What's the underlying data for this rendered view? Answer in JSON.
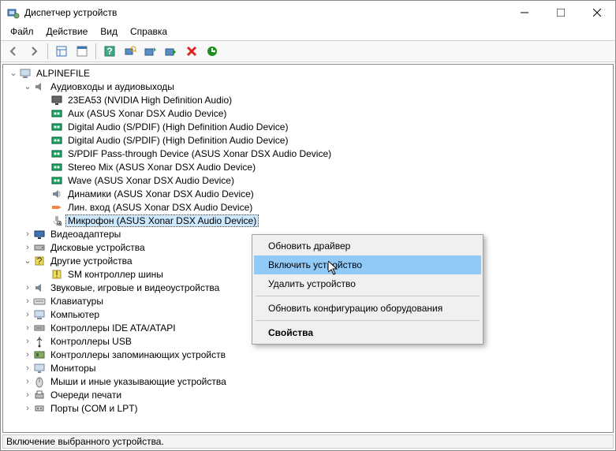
{
  "window": {
    "title": "Диспетчер устройств"
  },
  "menu": {
    "file": "Файл",
    "action": "Действие",
    "view": "Вид",
    "help": "Справка"
  },
  "root": {
    "label": "ALPINEFILE"
  },
  "tree": {
    "audio": {
      "label": "Аудиовходы и аудиовыходы",
      "items": [
        "23EA53 (NVIDIA High Definition Audio)",
        "Aux (ASUS Xonar DSX Audio Device)",
        "Digital Audio (S/PDIF) (High Definition Audio Device)",
        "Digital Audio (S/PDIF) (High Definition Audio Device)",
        "S/PDIF Pass-through Device (ASUS Xonar DSX Audio Device)",
        "Stereo Mix (ASUS Xonar DSX Audio Device)",
        "Wave (ASUS Xonar DSX Audio Device)",
        "Динамики (ASUS Xonar DSX Audio Device)",
        "Лин. вход (ASUS Xonar DSX Audio Device)",
        "Микрофон (ASUS Xonar DSX Audio Device)"
      ]
    },
    "display": {
      "label": "Видеоадаптеры"
    },
    "disk": {
      "label": "Дисковые устройства"
    },
    "other": {
      "label": "Другие устройства",
      "items": [
        "SM контроллер шины"
      ]
    },
    "game": {
      "label": "Звуковые, игровые и видеоустройства"
    },
    "keyboard": {
      "label": "Клавиатуры"
    },
    "computer": {
      "label": "Компьютер"
    },
    "ide": {
      "label": "Контроллеры IDE ATA/ATAPI"
    },
    "usb": {
      "label": "Контроллеры USB"
    },
    "storage": {
      "label": "Контроллеры запоминающих устройств"
    },
    "monitor": {
      "label": "Мониторы"
    },
    "mouse": {
      "label": "Мыши и иные указывающие устройства"
    },
    "printq": {
      "label": "Очереди печати"
    },
    "ports": {
      "label": "Порты (COM и LPT)"
    }
  },
  "ctx": {
    "update": "Обновить драйвер",
    "enable": "Включить устройство",
    "delete": "Удалить устройство",
    "scan": "Обновить конфигурацию оборудования",
    "props": "Свойства"
  },
  "status": {
    "text": "Включение выбранного устройства."
  }
}
